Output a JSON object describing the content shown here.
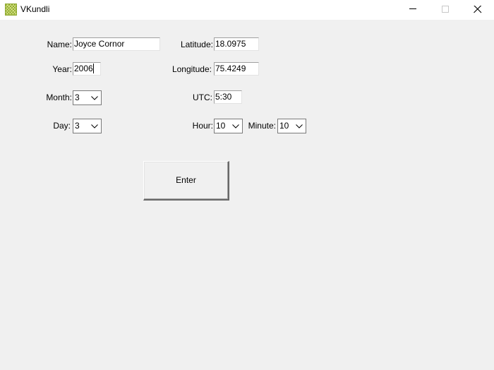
{
  "window": {
    "title": "VKundli",
    "icons": {
      "app": "crosshatch-app-icon",
      "minimize": "minimize-icon",
      "maximize": "maximize-icon",
      "close": "close-icon"
    }
  },
  "form": {
    "name": {
      "label": "Name:",
      "value": "Joyce Cornor"
    },
    "year": {
      "label": "Year:",
      "value": "2006"
    },
    "month": {
      "label": "Month:",
      "value": "3"
    },
    "day": {
      "label": "Day:",
      "value": "3"
    },
    "latitude": {
      "label": "Latitude:",
      "value": "18.0975"
    },
    "longitude": {
      "label": "Longitude:",
      "value": "75.4249"
    },
    "utc": {
      "label": "UTC:",
      "value": "5:30"
    },
    "hour": {
      "label": "Hour:",
      "value": "10"
    },
    "minute": {
      "label": "Minute:",
      "value": "10"
    },
    "enter_label": "Enter"
  },
  "colors": {
    "window_bg": "#f0f0f0",
    "titlebar_bg": "#ffffff",
    "app_icon": "#a8c33a"
  }
}
